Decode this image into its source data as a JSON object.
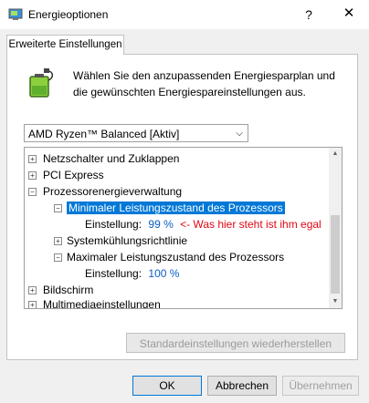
{
  "window": {
    "title": "Energieoptionen",
    "help_glyph": "?",
    "close_glyph": "✕"
  },
  "tab": {
    "label": "Erweiterte Einstellungen"
  },
  "description": "Wählen Sie den anzupassenden Energiesparplan und die gewünschten Energiespareinstellungen aus.",
  "plan_select": {
    "value": "AMD Ryzen™ Balanced [Aktiv]"
  },
  "tree": {
    "items": [
      {
        "label": "Netzschalter und Zuklappen",
        "expander": "+"
      },
      {
        "label": "PCI Express",
        "expander": "+"
      },
      {
        "label": "Prozessorenergieverwaltung",
        "expander": "−"
      },
      {
        "label": "Minimaler Leistungszustand des Prozessors",
        "expander": "−"
      },
      {
        "label": "Einstellung:",
        "value": "99 %",
        "note": "<- Was hier steht ist ihm egal"
      },
      {
        "label": "Systemkühlungsrichtlinie",
        "expander": "+"
      },
      {
        "label": "Maximaler Leistungszustand des Prozessors",
        "expander": "−"
      },
      {
        "label": "Einstellung:",
        "value": "100 %"
      },
      {
        "label": "Bildschirm",
        "expander": "+"
      },
      {
        "label": "Multimediaeinstellungen",
        "expander": "+"
      }
    ]
  },
  "buttons": {
    "restore": "Standardeinstellungen wiederherstellen",
    "ok": "OK",
    "cancel": "Abbrechen",
    "apply": "Übernehmen"
  },
  "colors": {
    "selection": "#0078d7",
    "setting_value": "#0b5fc2",
    "annotation": "#e30613"
  }
}
